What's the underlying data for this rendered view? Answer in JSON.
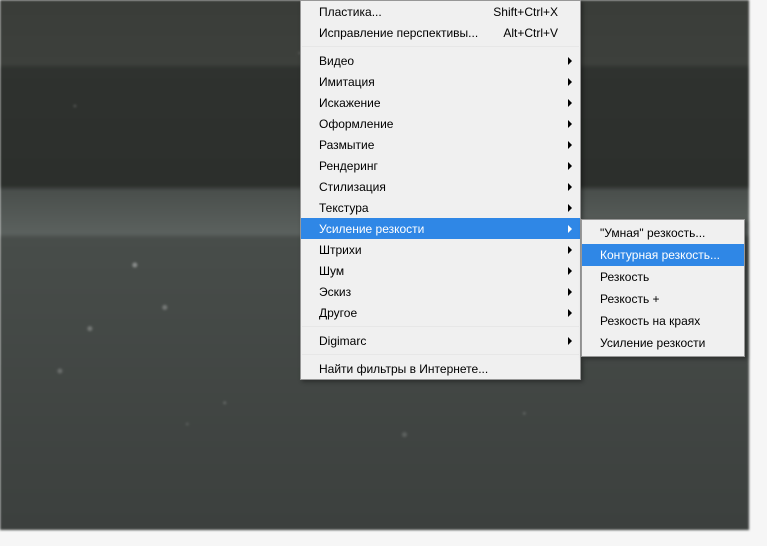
{
  "main_menu": {
    "group1": [
      {
        "label": "Пластика...",
        "shortcut": "Shift+Ctrl+X"
      },
      {
        "label": "Исправление перспективы...",
        "shortcut": "Alt+Ctrl+V"
      }
    ],
    "group2": [
      {
        "label": "Видео",
        "submenu": true
      },
      {
        "label": "Имитация",
        "submenu": true
      },
      {
        "label": "Искажение",
        "submenu": true
      },
      {
        "label": "Оформление",
        "submenu": true
      },
      {
        "label": "Размытие",
        "submenu": true
      },
      {
        "label": "Рендеринг",
        "submenu": true
      },
      {
        "label": "Стилизация",
        "submenu": true
      },
      {
        "label": "Текстура",
        "submenu": true
      },
      {
        "label": "Усиление резкости",
        "submenu": true,
        "selected": true
      },
      {
        "label": "Штрихи",
        "submenu": true
      },
      {
        "label": "Шум",
        "submenu": true
      },
      {
        "label": "Эскиз",
        "submenu": true
      },
      {
        "label": "Другое",
        "submenu": true
      }
    ],
    "group3": [
      {
        "label": "Digimarc",
        "submenu": true
      }
    ],
    "group4": [
      {
        "label": "Найти фильтры в Интернете..."
      }
    ]
  },
  "submenu": {
    "items": [
      {
        "label": "\"Умная\" резкость..."
      },
      {
        "label": "Контурная резкость...",
        "selected": true
      },
      {
        "label": "Резкость"
      },
      {
        "label": "Резкость +"
      },
      {
        "label": "Резкость на краях"
      },
      {
        "label": "Усиление резкости"
      }
    ]
  }
}
